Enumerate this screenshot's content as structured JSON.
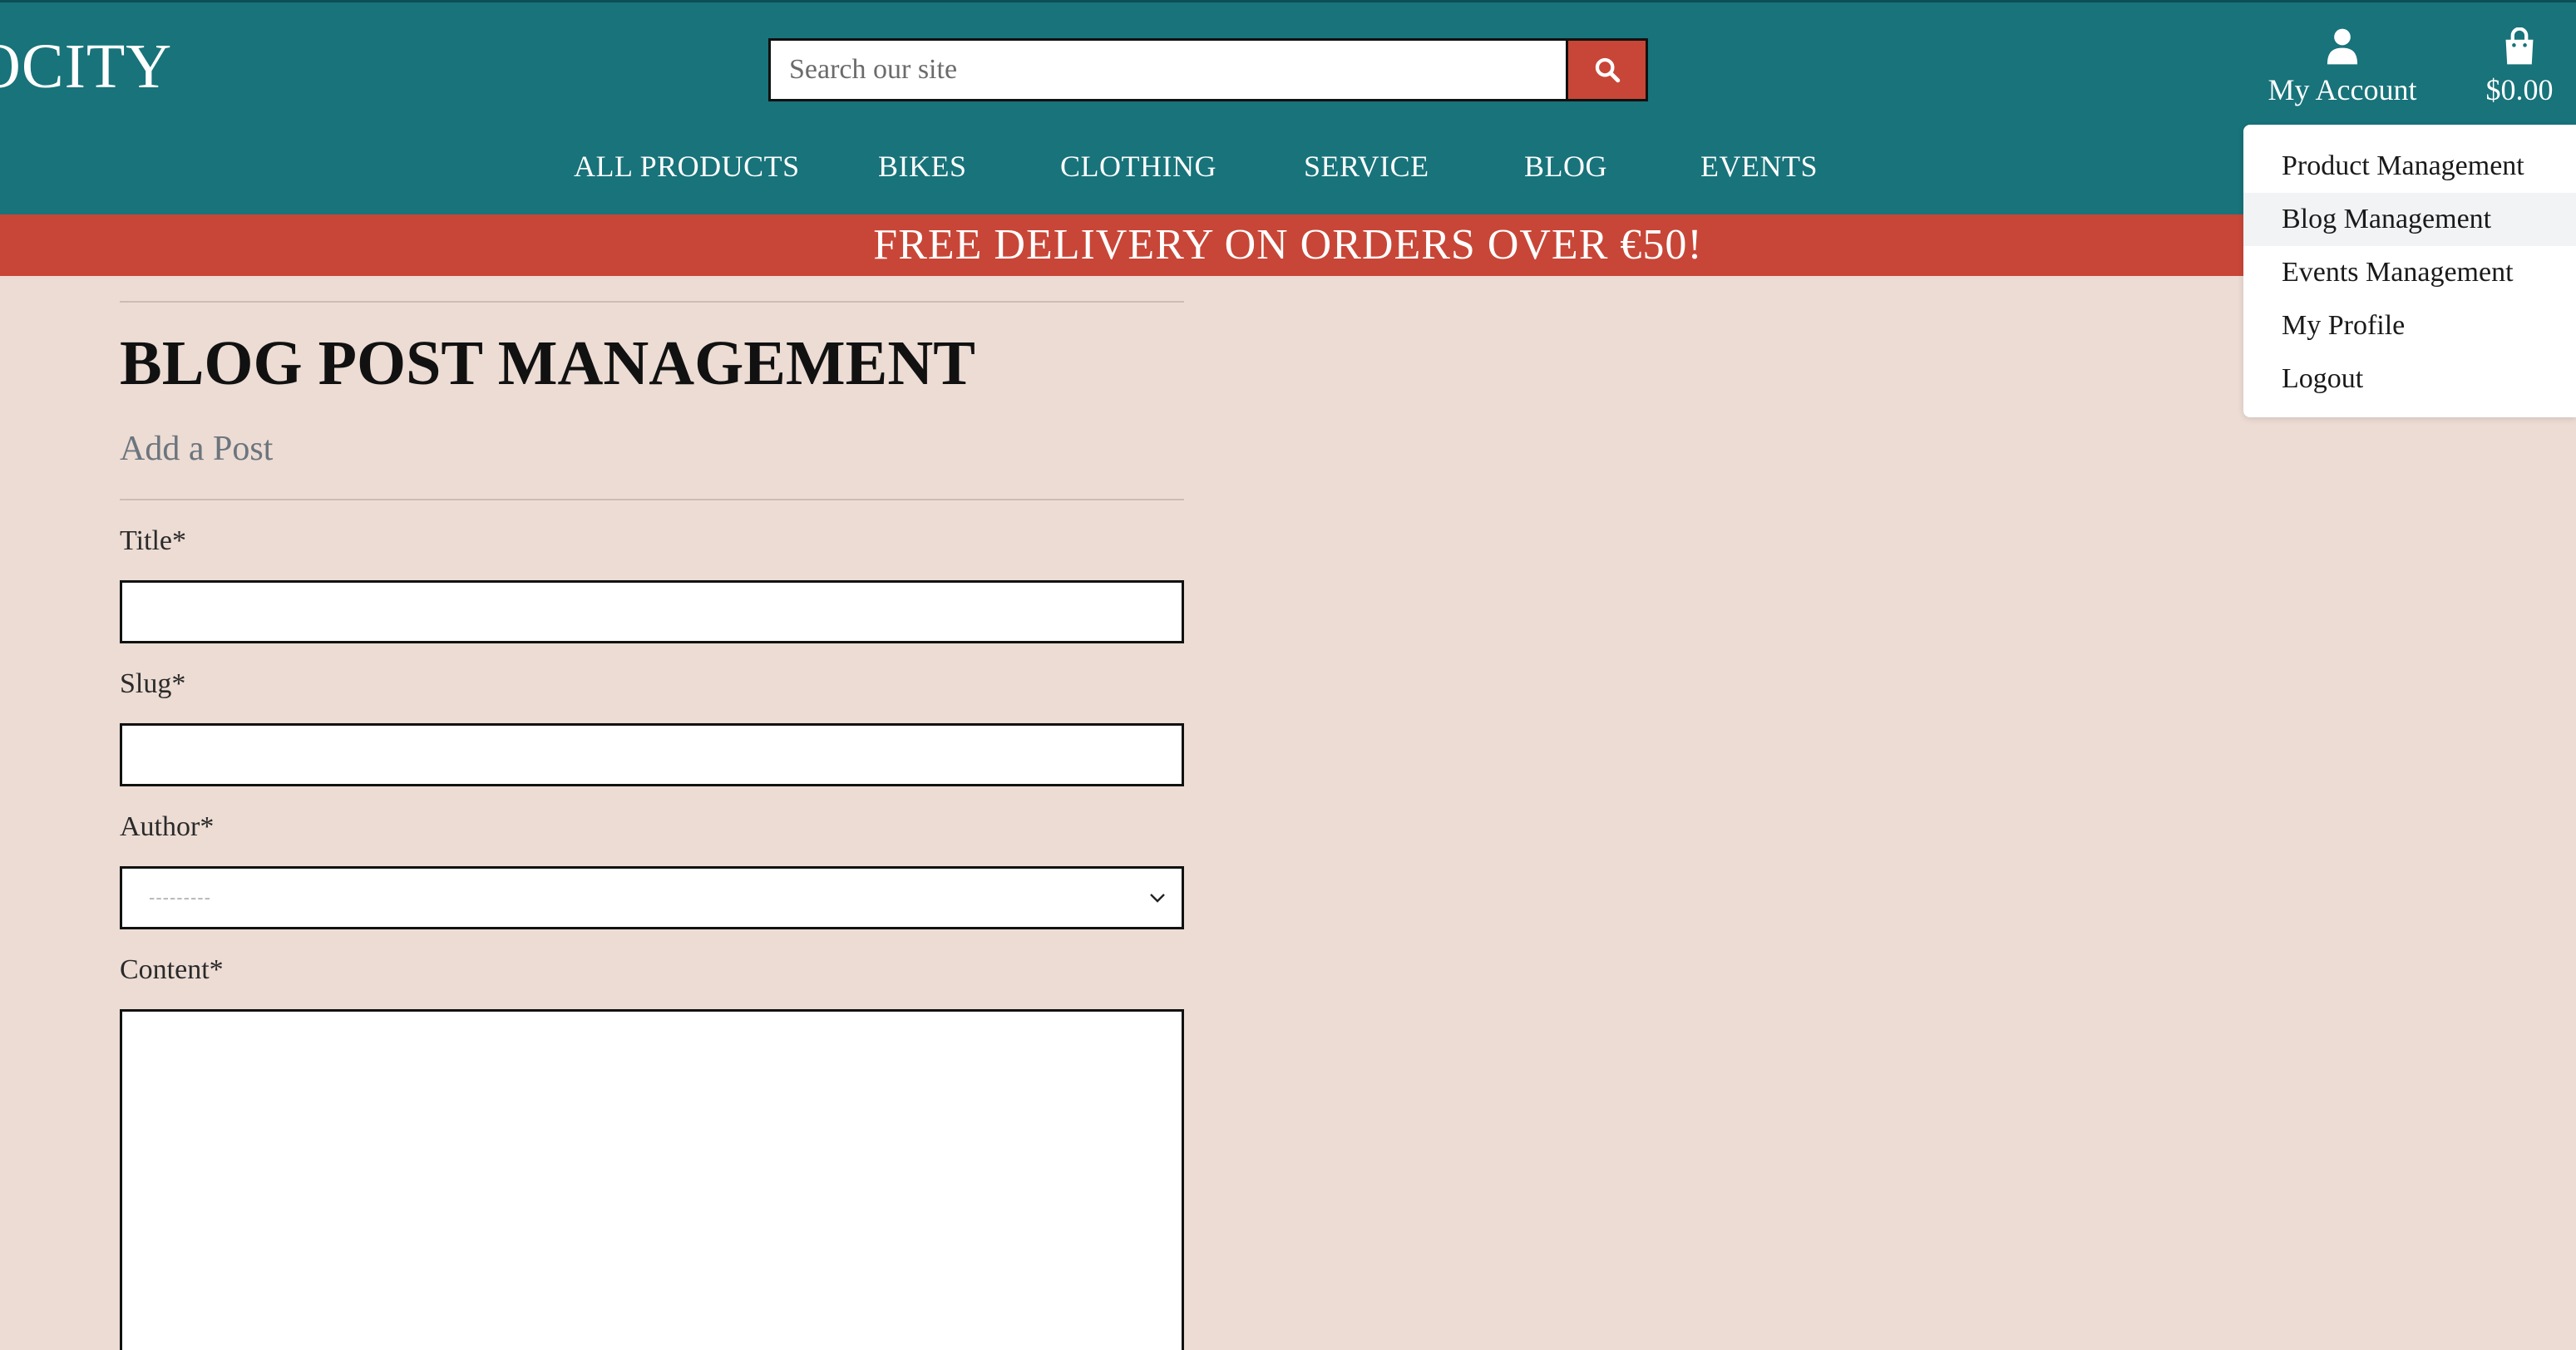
{
  "header": {
    "logo_text": "OCITY",
    "search": {
      "placeholder": "Search our site"
    },
    "account": {
      "label": "My Account"
    },
    "cart": {
      "total": "$0.00"
    },
    "nav": [
      {
        "label": "ALL PRODUCTS"
      },
      {
        "label": "BIKES"
      },
      {
        "label": "CLOTHING"
      },
      {
        "label": "SERVICE"
      },
      {
        "label": "BLOG"
      },
      {
        "label": "EVENTS"
      }
    ]
  },
  "banner": {
    "text": "FREE DELIVERY ON ORDERS OVER €50!"
  },
  "account_menu": {
    "items": [
      {
        "label": "Product Management"
      },
      {
        "label": "Blog Management",
        "active": true
      },
      {
        "label": "Events Management"
      },
      {
        "label": "My Profile"
      },
      {
        "label": "Logout"
      }
    ]
  },
  "main": {
    "title": "BLOG POST MANAGEMENT",
    "subtitle": "Add a Post",
    "form": {
      "title_label": "Title*",
      "title_value": "",
      "slug_label": "Slug*",
      "slug_value": "",
      "author_label": "Author*",
      "author_selected": "---------",
      "content_label": "Content*",
      "content_value": ""
    }
  },
  "colors": {
    "header_bg": "#18737a",
    "banner_bg": "#c84637",
    "search_button_bg": "#c84637",
    "page_bg": "#ecdcd4"
  },
  "icons": {
    "search": "magnifier-icon",
    "account": "user-icon",
    "cart": "shopping-bag-icon",
    "select": "chevron-down-icon"
  }
}
